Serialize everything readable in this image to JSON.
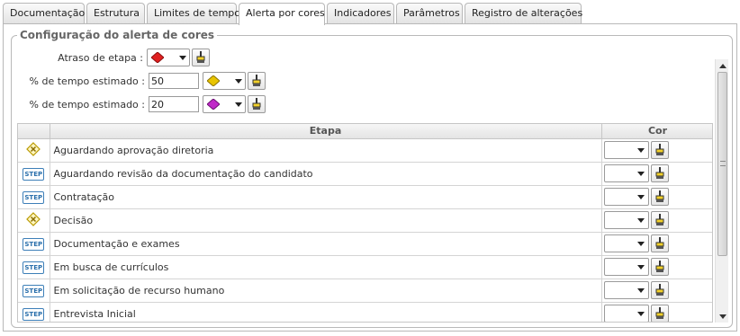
{
  "tabs": [
    {
      "label": "Documentação"
    },
    {
      "label": "Estrutura"
    },
    {
      "label": "Limites de tempo"
    },
    {
      "label": "Alerta por cores",
      "active": true
    },
    {
      "label": "Indicadores"
    },
    {
      "label": "Parâmetros"
    },
    {
      "label": "Registro de alterações"
    }
  ],
  "group": {
    "title": "Configuração do alerta de cores",
    "fields": {
      "delay": {
        "label": "Atraso de etapa :",
        "color": "#e02020"
      },
      "pct1": {
        "label": "% de tempo estimado :",
        "value": "50",
        "color": "#e8c400"
      },
      "pct2": {
        "label": "% de tempo estimado :",
        "value": "20",
        "color": "#c02ac8"
      }
    }
  },
  "table": {
    "headers": {
      "etapa": "Etapa",
      "cor": "Cor"
    },
    "rows": [
      {
        "icon": "decision-icon",
        "name": "Aguardando aprovação diretoria"
      },
      {
        "icon": "step-icon",
        "name": "Aguardando revisão da documentação do candidato"
      },
      {
        "icon": "step-icon",
        "name": "Contratação"
      },
      {
        "icon": "decision-icon",
        "name": "Decisão"
      },
      {
        "icon": "step-icon",
        "name": "Documentação e exames"
      },
      {
        "icon": "step-icon",
        "name": "Em busca de currículos"
      },
      {
        "icon": "step-icon",
        "name": "Em solicitação de recurso humano"
      },
      {
        "icon": "step-icon",
        "name": "Entrevista Inicial"
      }
    ]
  },
  "icons": {
    "step_text": "STEP",
    "paint": "paint-brush-icon",
    "gem": "gem-icon"
  }
}
